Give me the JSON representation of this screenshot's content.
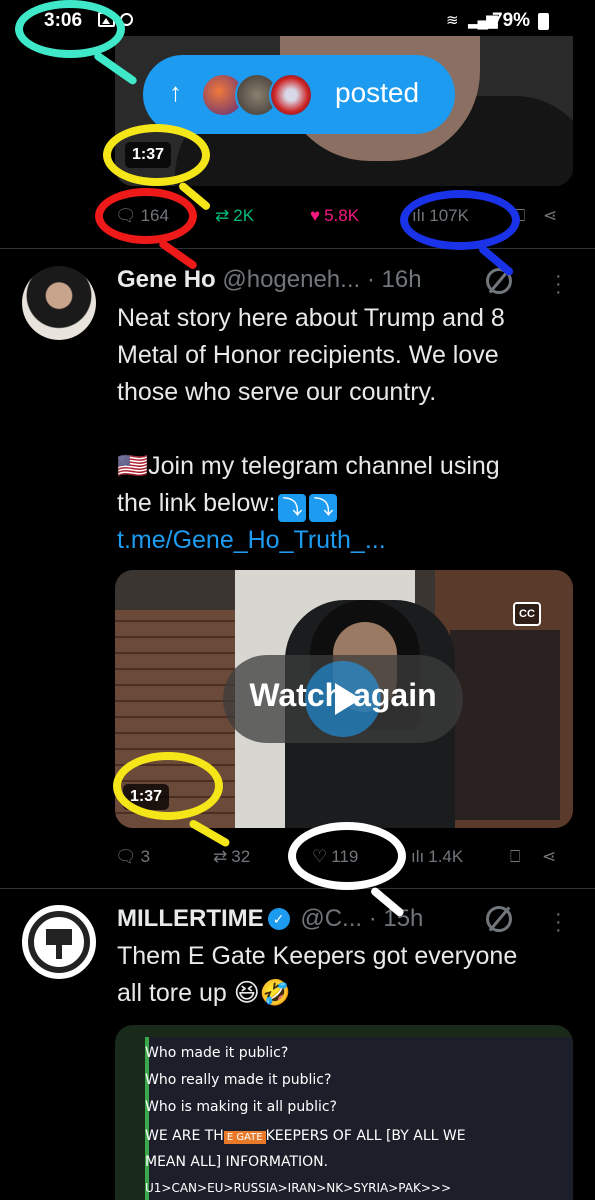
{
  "status_bar": {
    "time": "3:06",
    "battery": "79%"
  },
  "notification": {
    "arrow": "↑",
    "label": "posted"
  },
  "tweet1": {
    "duration": "1:37",
    "stats": {
      "replies": "164",
      "reposts": "2K",
      "likes": "5.8K",
      "views": "107K"
    }
  },
  "tweet2": {
    "name": "Gene Ho",
    "handle": "@hogeneh...",
    "time": "· 16h",
    "text_line1": "Neat story here about Trump and 8",
    "text_line2": "Metal of Honor recipients. We love",
    "text_line3": "those who serve our country.",
    "text_line4": "🇺🇸Join my telegram channel using",
    "text_line5": "the link below:",
    "arrows": "⤵",
    "link": "t.me/Gene_Ho_Truth_...",
    "video": {
      "watch_again": "Watch again",
      "cc": "CC",
      "duration": "1:37"
    },
    "stats": {
      "replies": "3",
      "reposts": "32",
      "likes": "119",
      "views": "1.4K"
    }
  },
  "tweet3": {
    "name": "MILLERTIME",
    "handle": "@C...",
    "time": "· 15h",
    "text_line1": "Them E Gate Keepers got everyone",
    "text_line2": "all tore up 😆🤣",
    "screen_lines": [
      "Who made it public?",
      "Who really made it public?",
      "Who is making it all public?",
      "WE ARE TH",
      "E GATE",
      "KEEPERS OF ALL [BY ALL WE",
      "MEAN ALL] INFORMATION.",
      "U1>CAN>EU>RUSSIA>IRAN>NK>SYRIA>PAK>>>"
    ]
  },
  "colors": {
    "accent": "#1d9bf0",
    "annotation_cyan": "#3ee8c8",
    "annotation_yellow": "#f5e61a",
    "annotation_red": "#ee1a1a",
    "annotation_blue": "#1a32e8",
    "annotation_white": "#ffffff"
  }
}
